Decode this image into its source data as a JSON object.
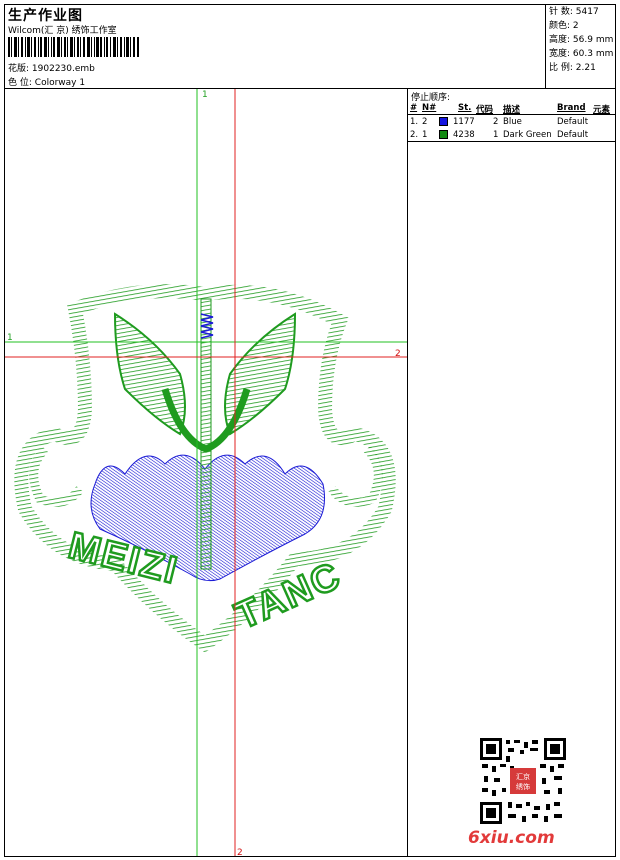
{
  "header": {
    "title": "生产作业图",
    "company": "Wilcom(汇 京) 绣饰工作室",
    "design_label": "花版:",
    "design_value": "1902230.emb",
    "colorway_label": "色 位:",
    "colorway_value": "Colorway 1"
  },
  "stats": [
    {
      "label": "针 数:",
      "value": "5417"
    },
    {
      "label": "颜色:",
      "value": "2"
    },
    {
      "label": "高度:",
      "value": "56.9 mm"
    },
    {
      "label": "宽度:",
      "value": "60.3 mm"
    },
    {
      "label": "比 例:",
      "value": "2.21"
    }
  ],
  "sequence": {
    "title": "停止顺序:",
    "headers": {
      "num": "#",
      "no": "N#",
      "st": "St.",
      "code": "代码",
      "desc": "描述",
      "brand": "Brand",
      "elem": "元素"
    },
    "rows": [
      {
        "num": "1.",
        "no": "2",
        "color": "#1515e0",
        "st": "1177",
        "code": "2",
        "desc": "Blue",
        "brand": "Default"
      },
      {
        "num": "2.",
        "no": "1",
        "color": "#128a12",
        "st": "4238",
        "code": "1",
        "desc": "Dark Green",
        "brand": "Default"
      }
    ]
  },
  "guides": {
    "green_label_top": "1",
    "green_label_left": "1",
    "red_label_right": "2",
    "red_label_bottom": "2"
  },
  "design": {
    "text_left": "MEIZI",
    "text_right": "TANC",
    "thread_green": "#1f9b1f",
    "thread_blue": "#1b1bd6"
  },
  "qr": {
    "stamp_text": "汇京\n绣饰"
  },
  "watermark": "6xiu.com"
}
